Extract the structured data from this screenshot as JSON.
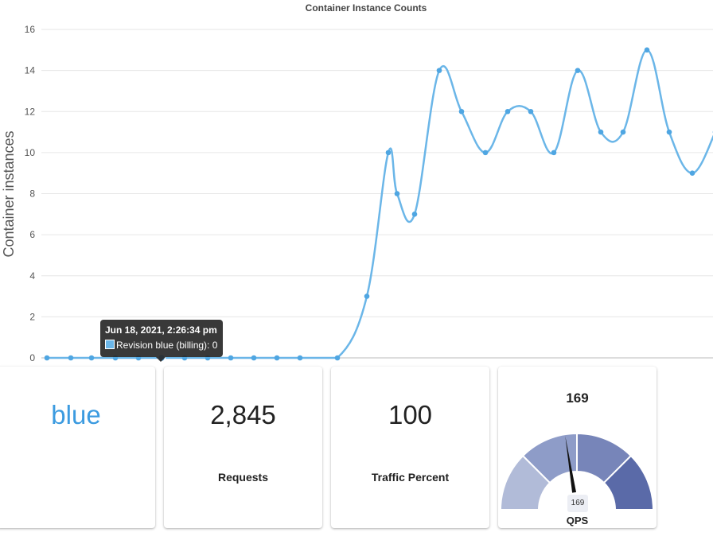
{
  "chart_data": {
    "type": "line",
    "title": "Container Instance Counts",
    "ylabel": "Container instances",
    "ylim": [
      0,
      16
    ],
    "yticks": [
      0,
      2,
      4,
      6,
      8,
      10,
      12,
      14,
      16
    ],
    "grid": true,
    "series": [
      {
        "name": "Revision blue (billing)",
        "color": "#6bb6e8",
        "values": [
          0,
          0,
          0,
          0,
          0,
          0,
          0,
          0,
          0,
          0,
          0,
          0,
          0,
          3,
          10,
          8,
          7,
          14,
          12,
          10,
          12,
          12,
          10,
          14,
          11,
          11,
          15,
          11,
          9,
          11
        ]
      }
    ],
    "tooltip": {
      "point_index": 5,
      "title": "Jun 18, 2021, 2:26:34 pm",
      "label": "Revision blue (billing): 0"
    }
  },
  "cards": {
    "revision": {
      "value": "blue"
    },
    "requests": {
      "value": "2,845",
      "label": "Requests"
    },
    "traffic": {
      "value": "100",
      "label": "Traffic Percent"
    },
    "qps": {
      "value": "169",
      "badge": "169",
      "label": "QPS",
      "gauge_fraction": 0.45
    }
  },
  "colors": {
    "line": "#6bb6e8",
    "accent_text": "#3c9be0",
    "gauge_segments": [
      "#b1bbd8",
      "#8e9cc8",
      "#7785b9",
      "#5a6aa8"
    ]
  }
}
